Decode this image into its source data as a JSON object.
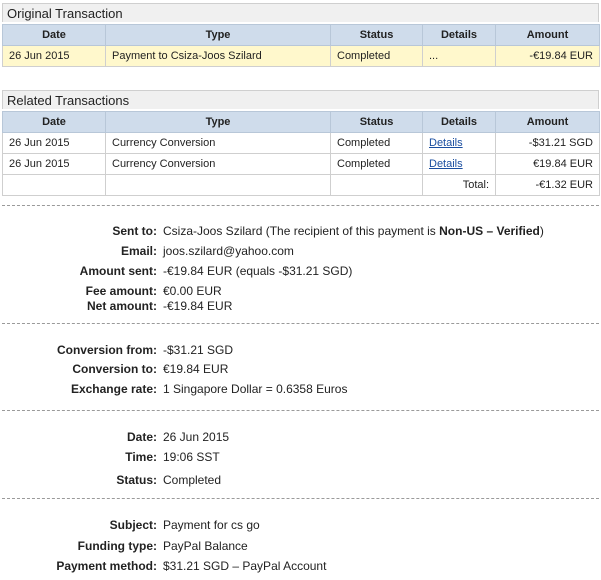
{
  "original": {
    "title": "Original Transaction",
    "headers": [
      "Date",
      "Type",
      "Status",
      "Details",
      "Amount"
    ],
    "row": {
      "date": "26 Jun 2015",
      "type": "Payment to Csiza-Joos Szilard",
      "status": "Completed",
      "details": "...",
      "amount": "-€19.84 EUR"
    }
  },
  "related": {
    "title": "Related Transactions",
    "headers": [
      "Date",
      "Type",
      "Status",
      "Details",
      "Amount"
    ],
    "rows": [
      {
        "date": "26 Jun 2015",
        "type": "Currency Conversion",
        "status": "Completed",
        "details": "Details",
        "amount": "-$31.21 SGD"
      },
      {
        "date": "26 Jun 2015",
        "type": "Currency Conversion",
        "status": "Completed",
        "details": "Details",
        "amount": "€19.84 EUR"
      }
    ],
    "total_label": "Total:",
    "total_value": "-€1.32 EUR"
  },
  "payment": {
    "sent_to_label": "Sent to:",
    "sent_to_name": "Csiza-Joos Szilard",
    "sent_to_note_prefix": "(The recipient of this payment is",
    "sent_to_status": "Non-US – Verified",
    "sent_to_note_suffix": ")",
    "email_label": "Email:",
    "email": "joos.szilard@yahoo.com",
    "amount_sent_label": "Amount sent:",
    "amount_sent": "-€19.84 EUR (equals -$31.21 SGD)",
    "fee_label": "Fee amount:",
    "fee": "€0.00 EUR",
    "net_label": "Net amount:",
    "net": "-€19.84 EUR"
  },
  "conversion": {
    "from_label": "Conversion from:",
    "from": "-$31.21 SGD",
    "to_label": "Conversion to:",
    "to": "€19.84 EUR",
    "rate_label": "Exchange rate:",
    "rate": "1 Singapore Dollar = 0.6358 Euros"
  },
  "timing": {
    "date_label": "Date:",
    "date": "26 Jun 2015",
    "time_label": "Time:",
    "time": "19:06 SST",
    "status_label": "Status:",
    "status": "Completed"
  },
  "funding": {
    "subject_label": "Subject:",
    "subject": "Payment for cs go",
    "funding_type_label": "Funding type:",
    "funding_type": "PayPal Balance",
    "method_label": "Payment method:",
    "method": "$31.21 SGD – PayPal Account"
  }
}
